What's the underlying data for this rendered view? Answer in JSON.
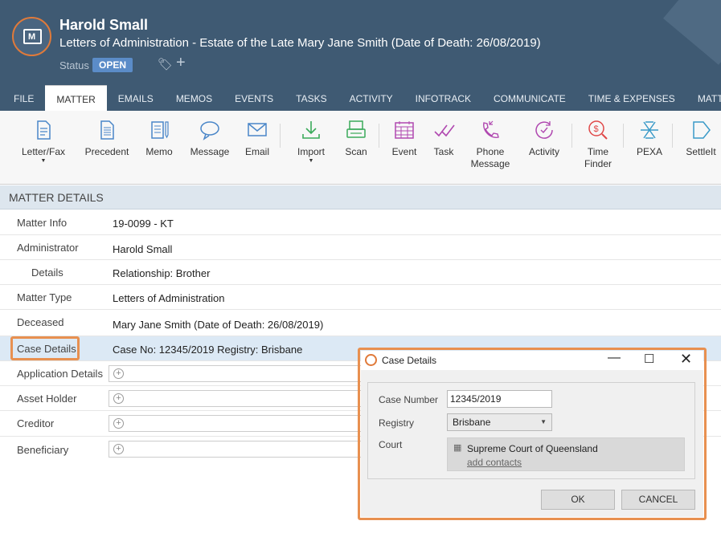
{
  "header": {
    "client_name": "Harold Small",
    "matter_desc": "Letters of Administration - Estate of the Late Mary Jane Smith (Date of Death: 26/08/2019)",
    "status_label": "Status",
    "status_value": "OPEN",
    "icon": "matter-folder-icon",
    "accent": "#e07a3a",
    "bg": "#3f5a73"
  },
  "tabs": [
    {
      "label": "FILE"
    },
    {
      "label": "MATTER"
    },
    {
      "label": "EMAILS"
    },
    {
      "label": "MEMOS"
    },
    {
      "label": "EVENTS"
    },
    {
      "label": "TASKS"
    },
    {
      "label": "ACTIVITY"
    },
    {
      "label": "INFOTRACK"
    },
    {
      "label": "COMMUNICATE"
    },
    {
      "label": "TIME & EXPENSES"
    },
    {
      "label": "MATTER INSIGH"
    }
  ],
  "active_tab": "MATTER",
  "ribbon": {
    "letter_fax": "Letter/Fax",
    "precedent": "Precedent",
    "memo": "Memo",
    "message": "Message",
    "email": "Email",
    "import": "Import",
    "scan": "Scan",
    "event": "Event",
    "task": "Task",
    "phone1": "Phone",
    "phone2": "Message",
    "activity": "Activity",
    "time1": "Time",
    "time2": "Finder",
    "pexa": "PEXA",
    "settleit": "SettleIt"
  },
  "section": {
    "title": "MATTER DETAILS"
  },
  "rows": {
    "matter_info": {
      "label": "Matter Info",
      "value": "19-0099 - KT"
    },
    "administrator": {
      "label": "Administrator",
      "value": "Harold Small"
    },
    "details": {
      "label": "Details",
      "value": "Relationship: Brother"
    },
    "matter_type": {
      "label": "Matter Type",
      "value": "Letters of Administration"
    },
    "deceased": {
      "label": "Deceased",
      "value": "Mary Jane Smith (Date of Death: 26/08/2019)"
    },
    "case_details": {
      "label": "Case Details",
      "value": "Case No: 12345/2019  Registry: Brisbane"
    },
    "application_details": {
      "label": "Application Details"
    },
    "asset_holder": {
      "label": "Asset Holder"
    },
    "creditor": {
      "label": "Creditor"
    },
    "beneficiary": {
      "label": "Beneficiary"
    }
  },
  "dialog": {
    "title": "Case Details",
    "case_number_label": "Case Number",
    "case_number_value": "12345/2019",
    "registry_label": "Registry",
    "registry_value": "Brisbane",
    "court_label": "Court",
    "court_value": "Supreme Court of Queensland",
    "add_contacts": "add contacts",
    "ok": "OK",
    "cancel": "CANCEL"
  }
}
